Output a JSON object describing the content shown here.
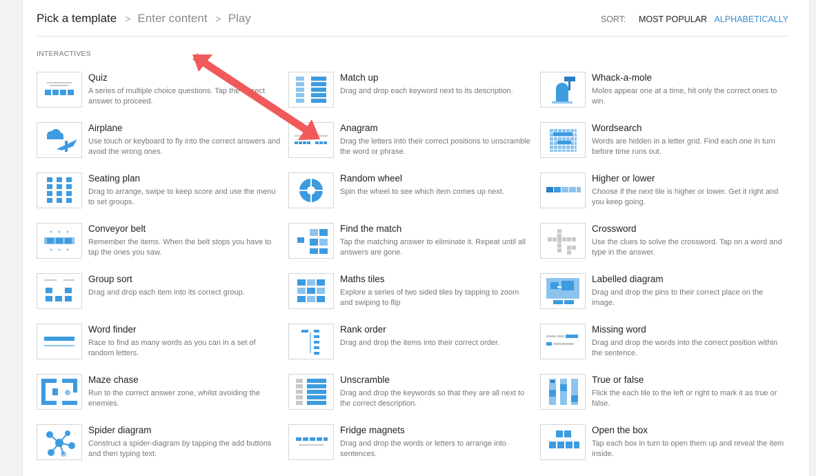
{
  "header": {
    "breadcrumb": [
      "Pick a template",
      "Enter content",
      "Play"
    ],
    "separator": ">",
    "sort": {
      "label": "SORT:",
      "options": [
        "MOST POPULAR",
        "ALPHABETICALLY"
      ],
      "selected": "MOST POPULAR"
    }
  },
  "section": {
    "title": "INTERACTIVES"
  },
  "colors": {
    "accent": "#3a8fc9",
    "tile": "#3d9be0",
    "arrow": "#f05a5a"
  },
  "templates": [
    {
      "title": "Quiz",
      "description": "A series of multiple choice questions. Tap the correct answer to proceed.",
      "icon": "quiz-icon"
    },
    {
      "title": "Match up",
      "description": "Drag and drop each keyword next to its description.",
      "icon": "match-up-icon"
    },
    {
      "title": "Whack-a-mole",
      "description": "Moles appear one at a time, hit only the correct ones to win.",
      "icon": "whack-a-mole-icon"
    },
    {
      "title": "Airplane",
      "description": "Use touch or keyboard to fly into the correct answers and avoid the wrong ones.",
      "icon": "airplane-icon"
    },
    {
      "title": "Anagram",
      "description": "Drag the letters into their correct positions to unscramble the word or phrase.",
      "icon": "anagram-icon"
    },
    {
      "title": "Wordsearch",
      "description": "Words are hidden in a letter grid. Find each one in turn before time runs out.",
      "icon": "wordsearch-icon"
    },
    {
      "title": "Seating plan",
      "description": "Drag to arrange, swipe to keep score and use the menu to set groups.",
      "icon": "seating-plan-icon"
    },
    {
      "title": "Random wheel",
      "description": "Spin the wheel to see which item comes up next.",
      "icon": "random-wheel-icon"
    },
    {
      "title": "Higher or lower",
      "description": "Choose if the next tile is higher or lower. Get it right and you keep going.",
      "icon": "higher-or-lower-icon"
    },
    {
      "title": "Conveyor belt",
      "description": "Remember the items. When the belt stops you have to tap the ones you saw.",
      "icon": "conveyor-belt-icon"
    },
    {
      "title": "Find the match",
      "description": "Tap the matching answer to eliminate it. Repeat until all answers are gone.",
      "icon": "find-the-match-icon"
    },
    {
      "title": "Crossword",
      "description": "Use the clues to solve the crossword. Tap on a word and type in the answer.",
      "icon": "crossword-icon"
    },
    {
      "title": "Group sort",
      "description": "Drag and drop each item into its correct group.",
      "icon": "group-sort-icon"
    },
    {
      "title": "Maths tiles",
      "description": "Explore a series of two sided tiles by tapping to zoom and swiping to flip",
      "icon": "maths-tiles-icon"
    },
    {
      "title": "Labelled diagram",
      "description": "Drag and drop the pins to their correct place on the image.",
      "icon": "labelled-diagram-icon"
    },
    {
      "title": "Word finder",
      "description": "Race to find as many words as you can in a set of random letters.",
      "icon": "word-finder-icon"
    },
    {
      "title": "Rank order",
      "description": "Drag and drop the items into their correct order.",
      "icon": "rank-order-icon"
    },
    {
      "title": "Missing word",
      "description": "Drag and drop the words into the correct position within the sentence.",
      "icon": "missing-word-icon"
    },
    {
      "title": "Maze chase",
      "description": "Run to the correct answer zone, whilst avoiding the enemies.",
      "icon": "maze-chase-icon"
    },
    {
      "title": "Unscramble",
      "description": "Drag and drop the keywords so that they are all next to the correct description.",
      "icon": "unscramble-icon"
    },
    {
      "title": "True or false",
      "description": "Flick the each tile to the left or right to mark it as true or false.",
      "icon": "true-or-false-icon"
    },
    {
      "title": "Spider diagram",
      "description": "Construct a spider-diagram by tapping the add buttons and then typing text.",
      "icon": "spider-diagram-icon"
    },
    {
      "title": "Fridge magnets",
      "description": "Drag and drop the words or letters to arrange into sentences.",
      "icon": "fridge-magnets-icon"
    },
    {
      "title": "Open the box",
      "description": "Tap each box in turn to open them up and reveal the item inside.",
      "icon": "open-the-box-icon"
    }
  ]
}
